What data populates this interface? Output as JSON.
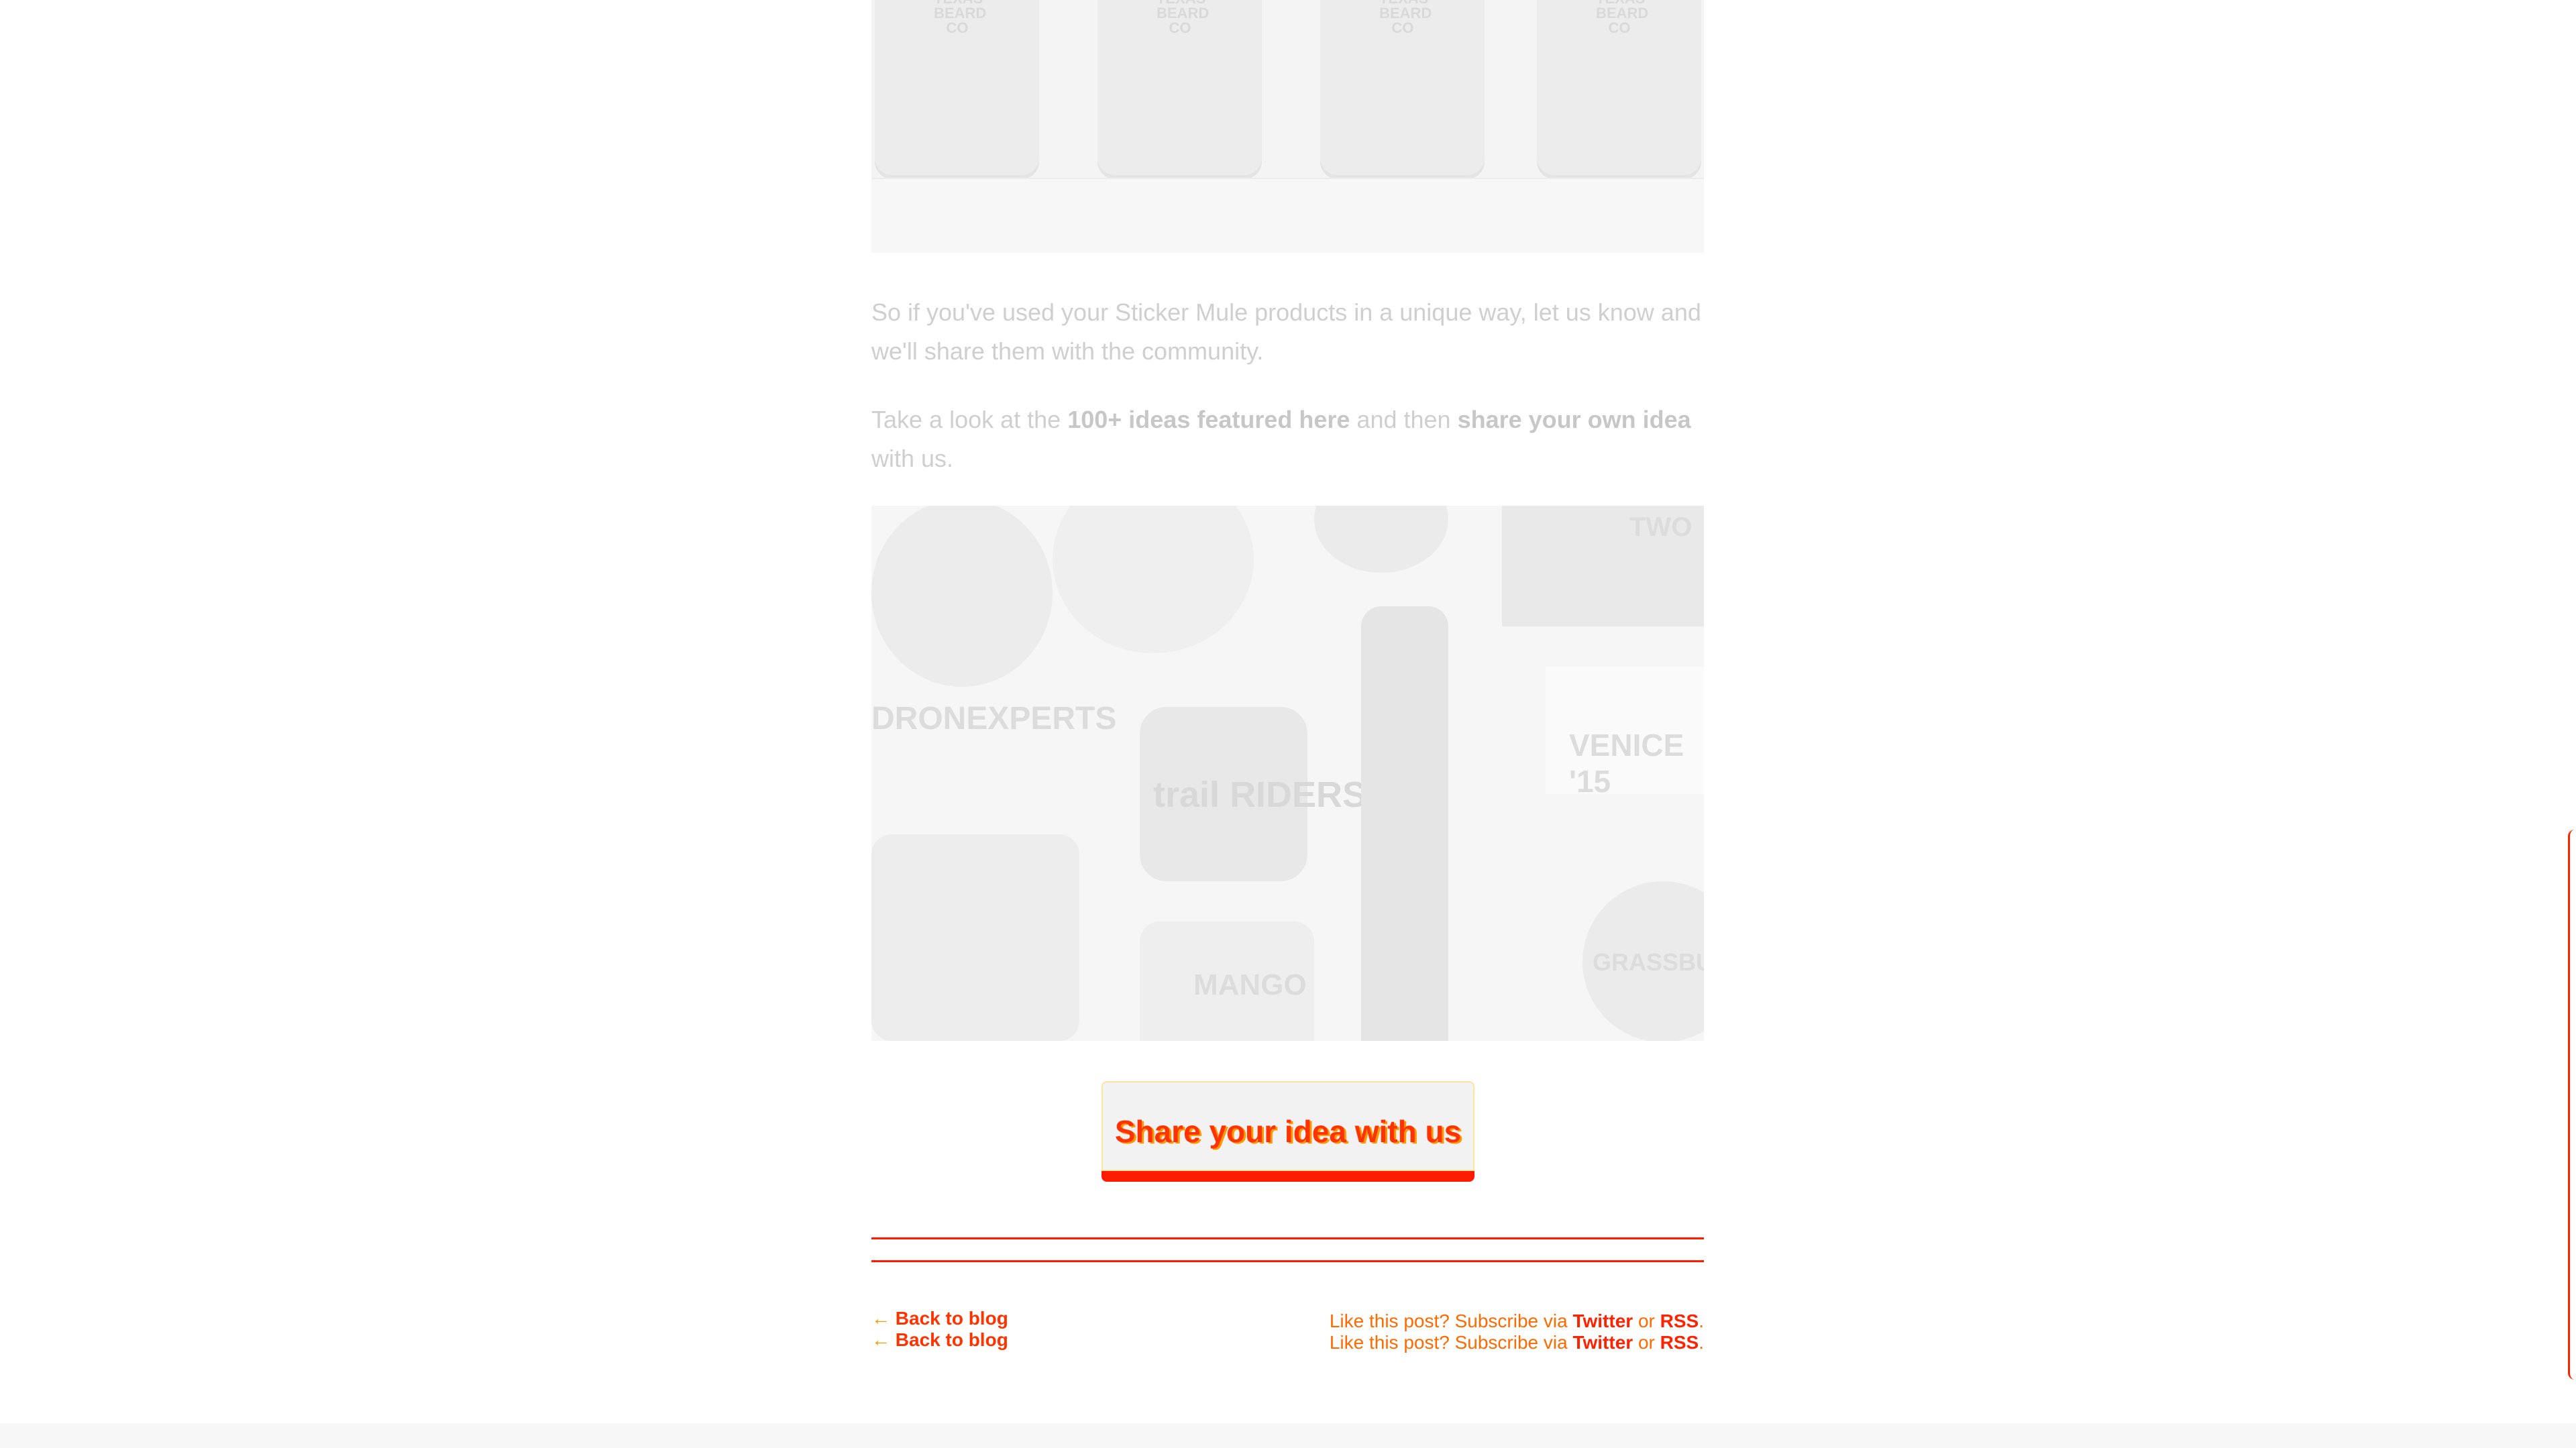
{
  "article": {
    "paragraph1": "So if you've used your Sticker Mule products in a unique way, let us know and we'll share them with the community.",
    "paragraph2_lead": "Take a look at the ",
    "paragraph2_link1": "100+ ideas featured here",
    "paragraph2_mid": " and then ",
    "paragraph2_link2": "share your own idea",
    "paragraph2_tail": " with us.",
    "top_image_labels": [
      "TEXAS BEARD CO",
      "TEXAS BEARD CO",
      "TEXAS BEARD CO",
      "TEXAS BEARD CO"
    ],
    "collage_labels": {
      "drone": "DRONEXPERTS",
      "trail": "trail RIDERS",
      "venice": "VENICE '15",
      "mango": "MANGO",
      "grass": "GRASSBURG",
      "two": "TWO"
    }
  },
  "cta": {
    "label": "Share your idea with us"
  },
  "footer": {
    "back_arrow": "←",
    "back_label": "Back to blog",
    "subscribe_prefix": "Like this post? Subscribe via ",
    "twitter": "Twitter",
    "or": " or ",
    "rss": "RSS",
    "period": "."
  },
  "colors": {
    "accent": "#ff1a00",
    "accent_secondary": "#ff9900",
    "muted_text": "#cfcfcf"
  }
}
